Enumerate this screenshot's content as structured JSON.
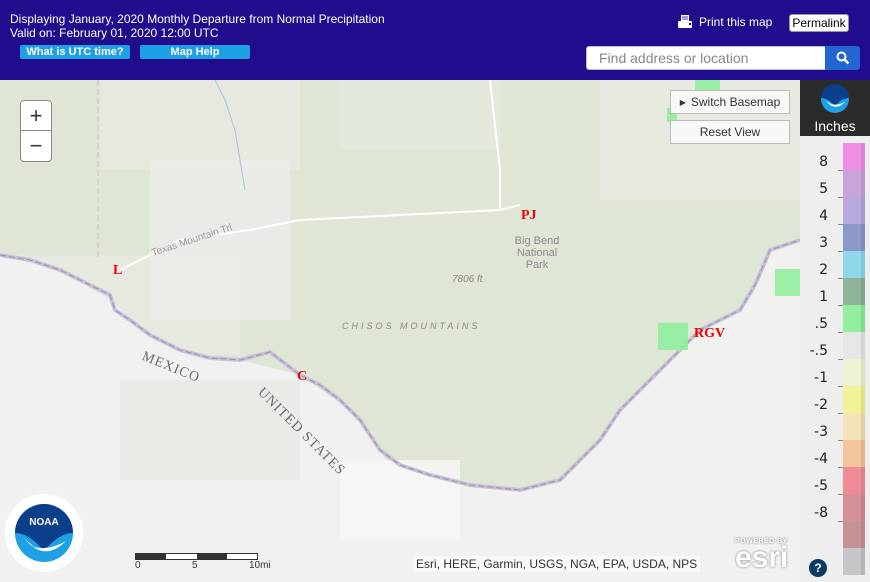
{
  "header": {
    "title_line1": "Displaying January, 2020 Monthly Departure from Normal Precipitation",
    "title_line2": "Valid on: February 01, 2020 12:00 UTC",
    "utc_button": "What is UTC time?",
    "help_button": "Map Help",
    "print_label": "Print this map",
    "permalink_label": "Permalink",
    "search_placeholder": "Find address or location",
    "search_value": ""
  },
  "map": {
    "zoom_in": "+",
    "zoom_out": "−",
    "switch_basemap": "Switch Basemap",
    "reset_view": "Reset View",
    "labels": {
      "park": [
        "Big Bend",
        "National",
        "Park"
      ],
      "elevation": "7806 ft",
      "range": "CHISOS MOUNTAINS",
      "mexico": "MEXICO",
      "us": "UNITED STATES",
      "trail": "Texas Mountain Trl"
    },
    "stations": [
      {
        "id": "PJ"
      },
      {
        "id": "L"
      },
      {
        "id": "C"
      },
      {
        "id": "RGV"
      }
    ],
    "scalebar": {
      "ticks": [
        "0",
        "5",
        "10mi"
      ]
    },
    "attribution": "Esri, HERE, Garmin, USGS, NGA, EPA, USDA, NPS",
    "esri_powered": "POWERED BY",
    "esri_name": "esri",
    "noaa_text": "NOAA"
  },
  "legend": {
    "unit": "Inches",
    "noaa_text": "NOAA",
    "items": [
      {
        "label": "8",
        "color": "#f08ee6"
      },
      {
        "label": "5",
        "color": "#c9a2dc"
      },
      {
        "label": "4",
        "color": "#b8a8e0"
      },
      {
        "label": "3",
        "color": "#8c98c8"
      },
      {
        "label": "2",
        "color": "#8fd8ec"
      },
      {
        "label": "1",
        "color": "#8fb49a"
      },
      {
        "label": ".5",
        "color": "#90ee9c"
      },
      {
        "label": "-.5",
        "color": "#e6e6e6"
      },
      {
        "label": "-1",
        "color": "#eef2d2"
      },
      {
        "label": "-2",
        "color": "#f2f296"
      },
      {
        "label": "-3",
        "color": "#f4e2b8"
      },
      {
        "label": "-4",
        "color": "#f4c49a"
      },
      {
        "label": "-5",
        "color": "#f08c98"
      },
      {
        "label": "-8",
        "color": "#d69098"
      },
      {
        "label": "",
        "color": "#c69296"
      },
      {
        "label": "",
        "color": "#c6c6c6"
      }
    ],
    "help": "?"
  }
}
